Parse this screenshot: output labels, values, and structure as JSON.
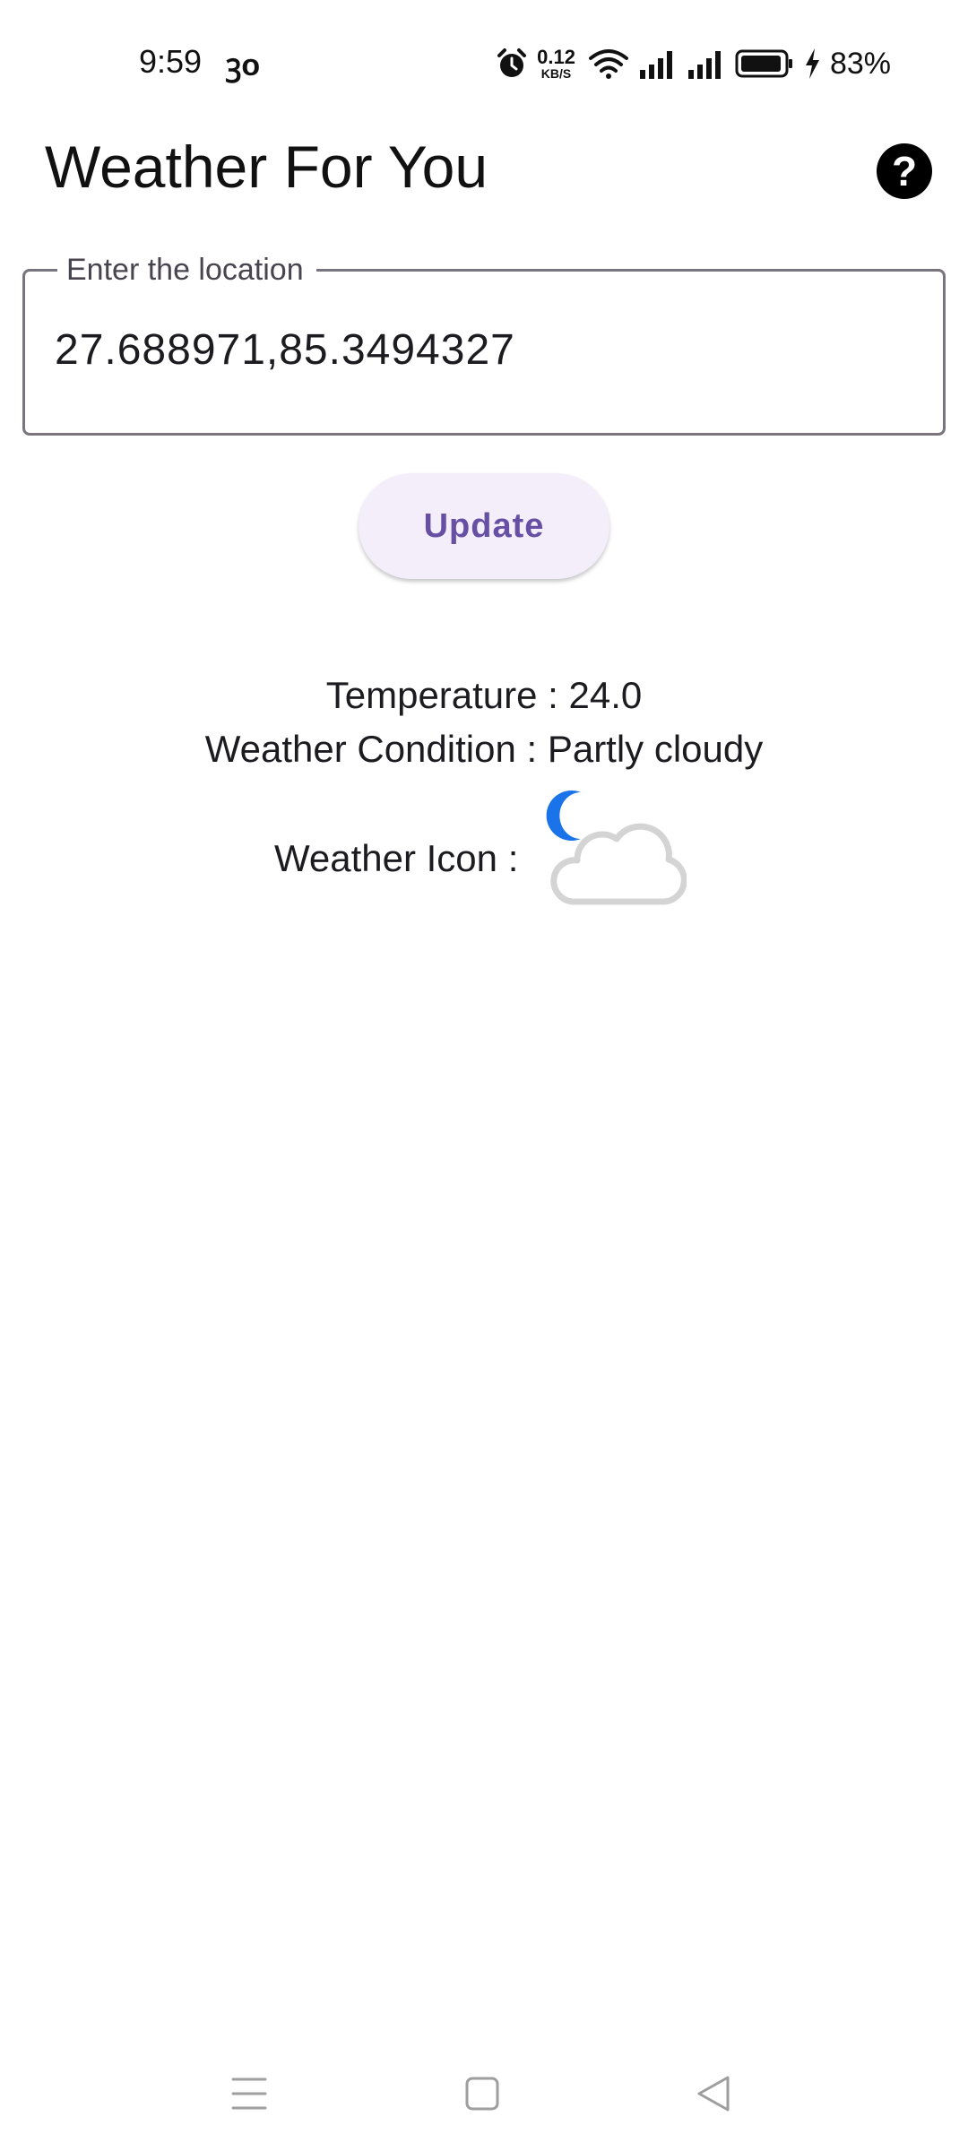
{
  "status_bar": {
    "time": "9:59",
    "extra_glyph": "ꝫo",
    "net_speed_value": "0.12",
    "net_speed_unit": "KB/S",
    "battery": "83%",
    "icons": [
      "alarm-icon",
      "wifi-icon",
      "signal-icon",
      "signal-icon",
      "battery-icon",
      "charging-icon"
    ]
  },
  "app_bar": {
    "title": "Weather For You",
    "help_icon": "help-icon"
  },
  "location_field": {
    "label": "Enter the location",
    "value": "27.688971,85.3494327"
  },
  "update_button": {
    "label": "Update"
  },
  "weather": {
    "temperature_text": "Temperature : 24.0",
    "condition_text": "Weather Condition : Partly cloudy",
    "icon_label": "Weather Icon :",
    "icon": "partly-cloudy-night-icon"
  },
  "nav_bar": {
    "icons": [
      "menu-icon",
      "home-icon",
      "back-icon"
    ]
  },
  "colors": {
    "accent": "#6750a4",
    "button_bg": "#f4eefa",
    "moon": "#1a73e8",
    "cloud": "#d4d4d4"
  }
}
